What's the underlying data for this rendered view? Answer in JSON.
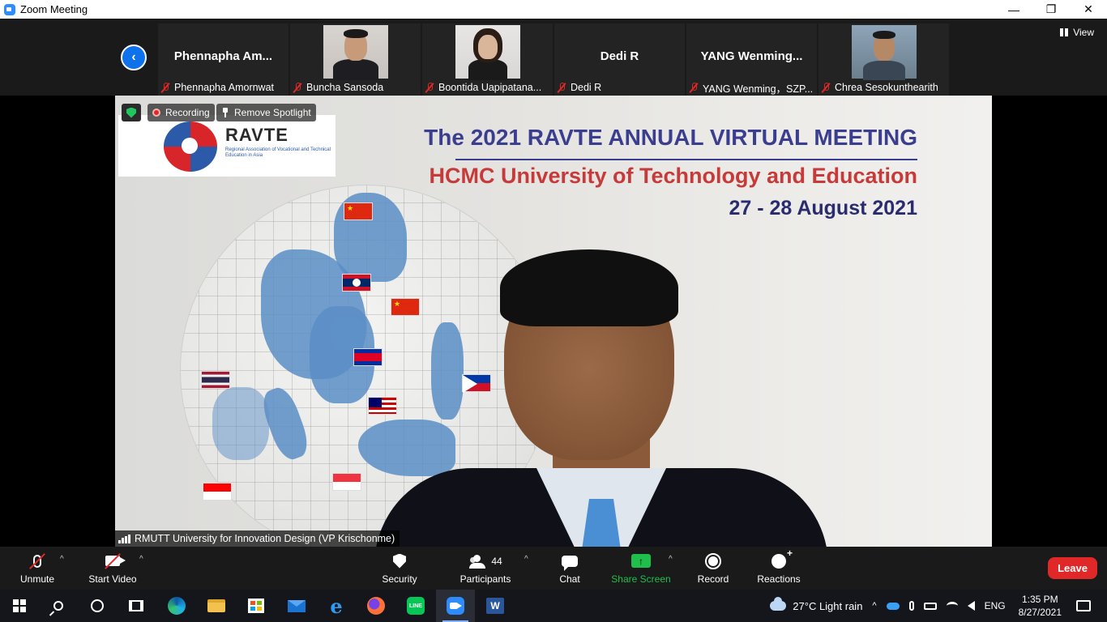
{
  "window": {
    "title": "Zoom Meeting",
    "controls": {
      "minimize": "—",
      "restore": "❐",
      "close": "✕"
    }
  },
  "gallery": {
    "prev_glyph": "‹",
    "view_label": "View",
    "tiles": [
      {
        "big_name": "Phennapha  Am...",
        "caption": "Phennapha Amornwat",
        "has_photo": false
      },
      {
        "big_name": "",
        "caption": "Buncha Sansoda",
        "has_photo": true
      },
      {
        "big_name": "",
        "caption": "Boontida Uapipatana...",
        "has_photo": true
      },
      {
        "big_name": "Dedi R",
        "caption": "Dedi R",
        "has_photo": false
      },
      {
        "big_name": "YANG  Wenming...",
        "caption": "YANG Wenming，SZP...",
        "has_photo": false
      },
      {
        "big_name": "",
        "caption": "Chrea Sesokunthearith",
        "has_photo": true
      }
    ]
  },
  "stage": {
    "badges": {
      "recording": "Recording",
      "remove_spotlight": "Remove Spotlight"
    },
    "slide": {
      "logo_text": "RAVTE",
      "logo_sub": "Regional Association of Vocational and Technical Education in Asia",
      "headline_1": "The 2021 RAVTE ANNUAL VIRTUAL MEETING",
      "headline_2": "HCMC University of Technology and Education",
      "headline_3": "27 - 28 August 2021"
    },
    "caption": "RMUTT University for Innovation Design (VP Krischonme)"
  },
  "toolbar": {
    "unmute": "Unmute",
    "start_video": "Start Video",
    "security": "Security",
    "participants": "Participants",
    "participants_count": "44",
    "chat": "Chat",
    "share_screen": "Share Screen",
    "share_glyph": "↑",
    "record": "Record",
    "reactions": "Reactions",
    "leave": "Leave",
    "caret": "^",
    "share_color": "#1fbf4c",
    "leave_color": "#e02828"
  },
  "taskbar": {
    "line_label": "LINE",
    "ie_glyph": "e",
    "word_glyph": "W",
    "weather": "27°C  Light rain",
    "up_chevron": "^",
    "language": "ENG",
    "time": "1:35 PM",
    "date": "8/27/2021"
  }
}
